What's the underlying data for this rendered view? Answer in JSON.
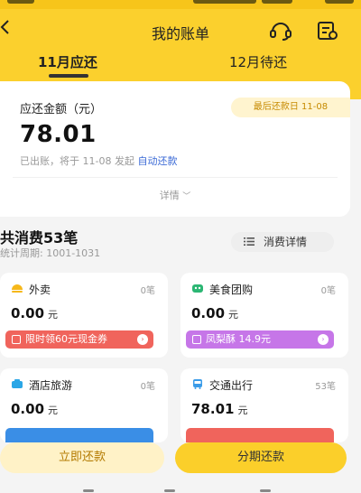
{
  "header": {
    "title": "我的账单",
    "back_icon": "chevron-left-icon",
    "service_icon": "headset-icon",
    "bill_icon": "bill-search-icon",
    "bg_color": "#fbd02d"
  },
  "tabs": [
    {
      "label": "11月应还",
      "active": true
    },
    {
      "label": "12月待还",
      "active": false
    }
  ],
  "summary": {
    "label": "应还金额（元）",
    "due_badge": "最后还款日 11-08",
    "amount": "78.01",
    "note_prefix": "已出账，将于 11-08 发起",
    "note_link": "自动还款",
    "detail": "详情"
  },
  "consumption": {
    "title": "共消费53笔",
    "period": "统计周期: 1001-1031",
    "detail_button": "消费详情"
  },
  "categories": [
    {
      "name": "外卖",
      "count": "0笔",
      "value": "0.00",
      "unit": "元",
      "icon": "takeout-icon",
      "coupon": "限时领60元现金券",
      "coupon_color": "#f0645c"
    },
    {
      "name": "美食团购",
      "count": "0笔",
      "value": "0.00",
      "unit": "元",
      "icon": "food-group-icon",
      "coupon": "凤梨酥 14.9元",
      "coupon_color": "#c676e8"
    },
    {
      "name": "酒店旅游",
      "count": "0笔",
      "value": "0.00",
      "unit": "元",
      "icon": "hotel-icon"
    },
    {
      "name": "交通出行",
      "count": "53笔",
      "value": "78.01",
      "unit": "元",
      "icon": "transport-icon"
    }
  ],
  "actions": {
    "pay_now": "立即还款",
    "installment": "分期还款"
  }
}
